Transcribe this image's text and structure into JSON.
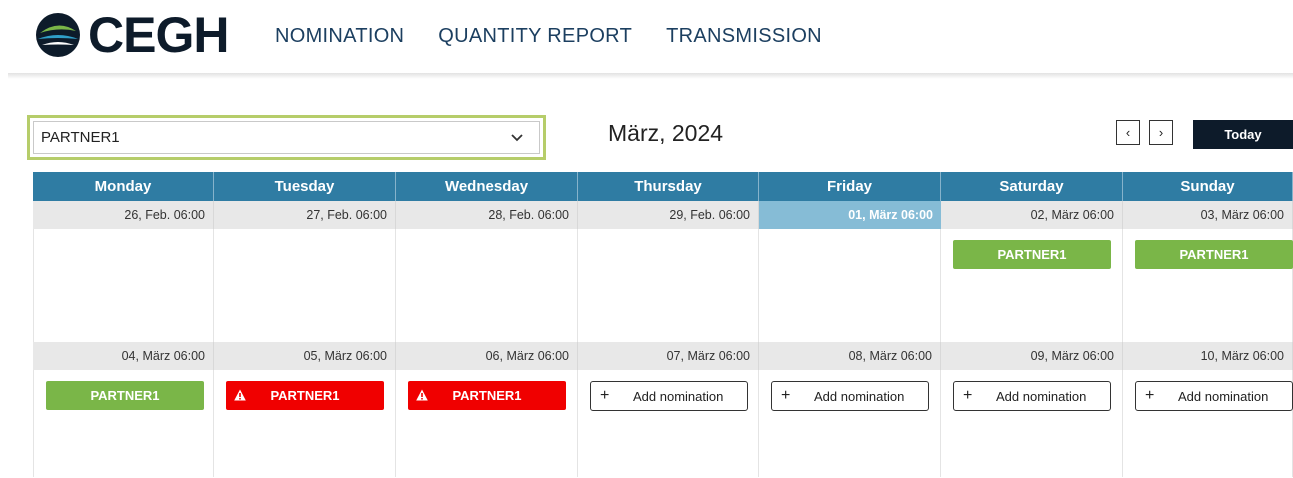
{
  "brand": {
    "name": "CEGH",
    "logo_icon": "ceGH-circle-logo-icon",
    "colors": {
      "dark": "#0d1b2a",
      "green": "#7ab648",
      "blue": "#2f7ca3"
    }
  },
  "nav": {
    "items": [
      "NOMINATION",
      "QUANTITY REPORT",
      "TRANSMISSION"
    ]
  },
  "partner_select": {
    "value": "PARTNER1"
  },
  "calendar": {
    "title": "März, 2024",
    "prev_icon": "chevron-left-icon",
    "next_icon": "chevron-right-icon",
    "prev_label": "‹",
    "next_label": "›",
    "today_label": "Today",
    "weekdays": [
      "Monday",
      "Tuesday",
      "Wednesday",
      "Thursday",
      "Friday",
      "Saturday",
      "Sunday"
    ],
    "weeks": [
      {
        "dates": [
          "26, Feb. 06:00",
          "27, Feb. 06:00",
          "28, Feb. 06:00",
          "29, Feb. 06:00",
          "01, März 06:00",
          "02, März 06:00",
          "03, März 06:00"
        ],
        "events": [
          null,
          null,
          null,
          null,
          null,
          {
            "label": "PARTNER1",
            "status": "ok"
          },
          {
            "label": "PARTNER1",
            "status": "ok"
          }
        ]
      },
      {
        "dates": [
          "04, März 06:00",
          "05, März 06:00",
          "06, März 06:00",
          "07, März 06:00",
          "08, März 06:00",
          "09, März 06:00",
          "10, März 06:00"
        ],
        "events": [
          {
            "label": "PARTNER1",
            "status": "ok"
          },
          {
            "label": "PARTNER1",
            "status": "warning"
          },
          {
            "label": "PARTNER1",
            "status": "warning"
          },
          {
            "label": "Add nomination",
            "status": "add"
          },
          {
            "label": "Add nomination",
            "status": "add"
          },
          {
            "label": "Add nomination",
            "status": "add"
          },
          {
            "label": "Add nomination",
            "status": "add"
          }
        ]
      }
    ],
    "today_date": "01, März 06:00",
    "add_plus": "+"
  }
}
